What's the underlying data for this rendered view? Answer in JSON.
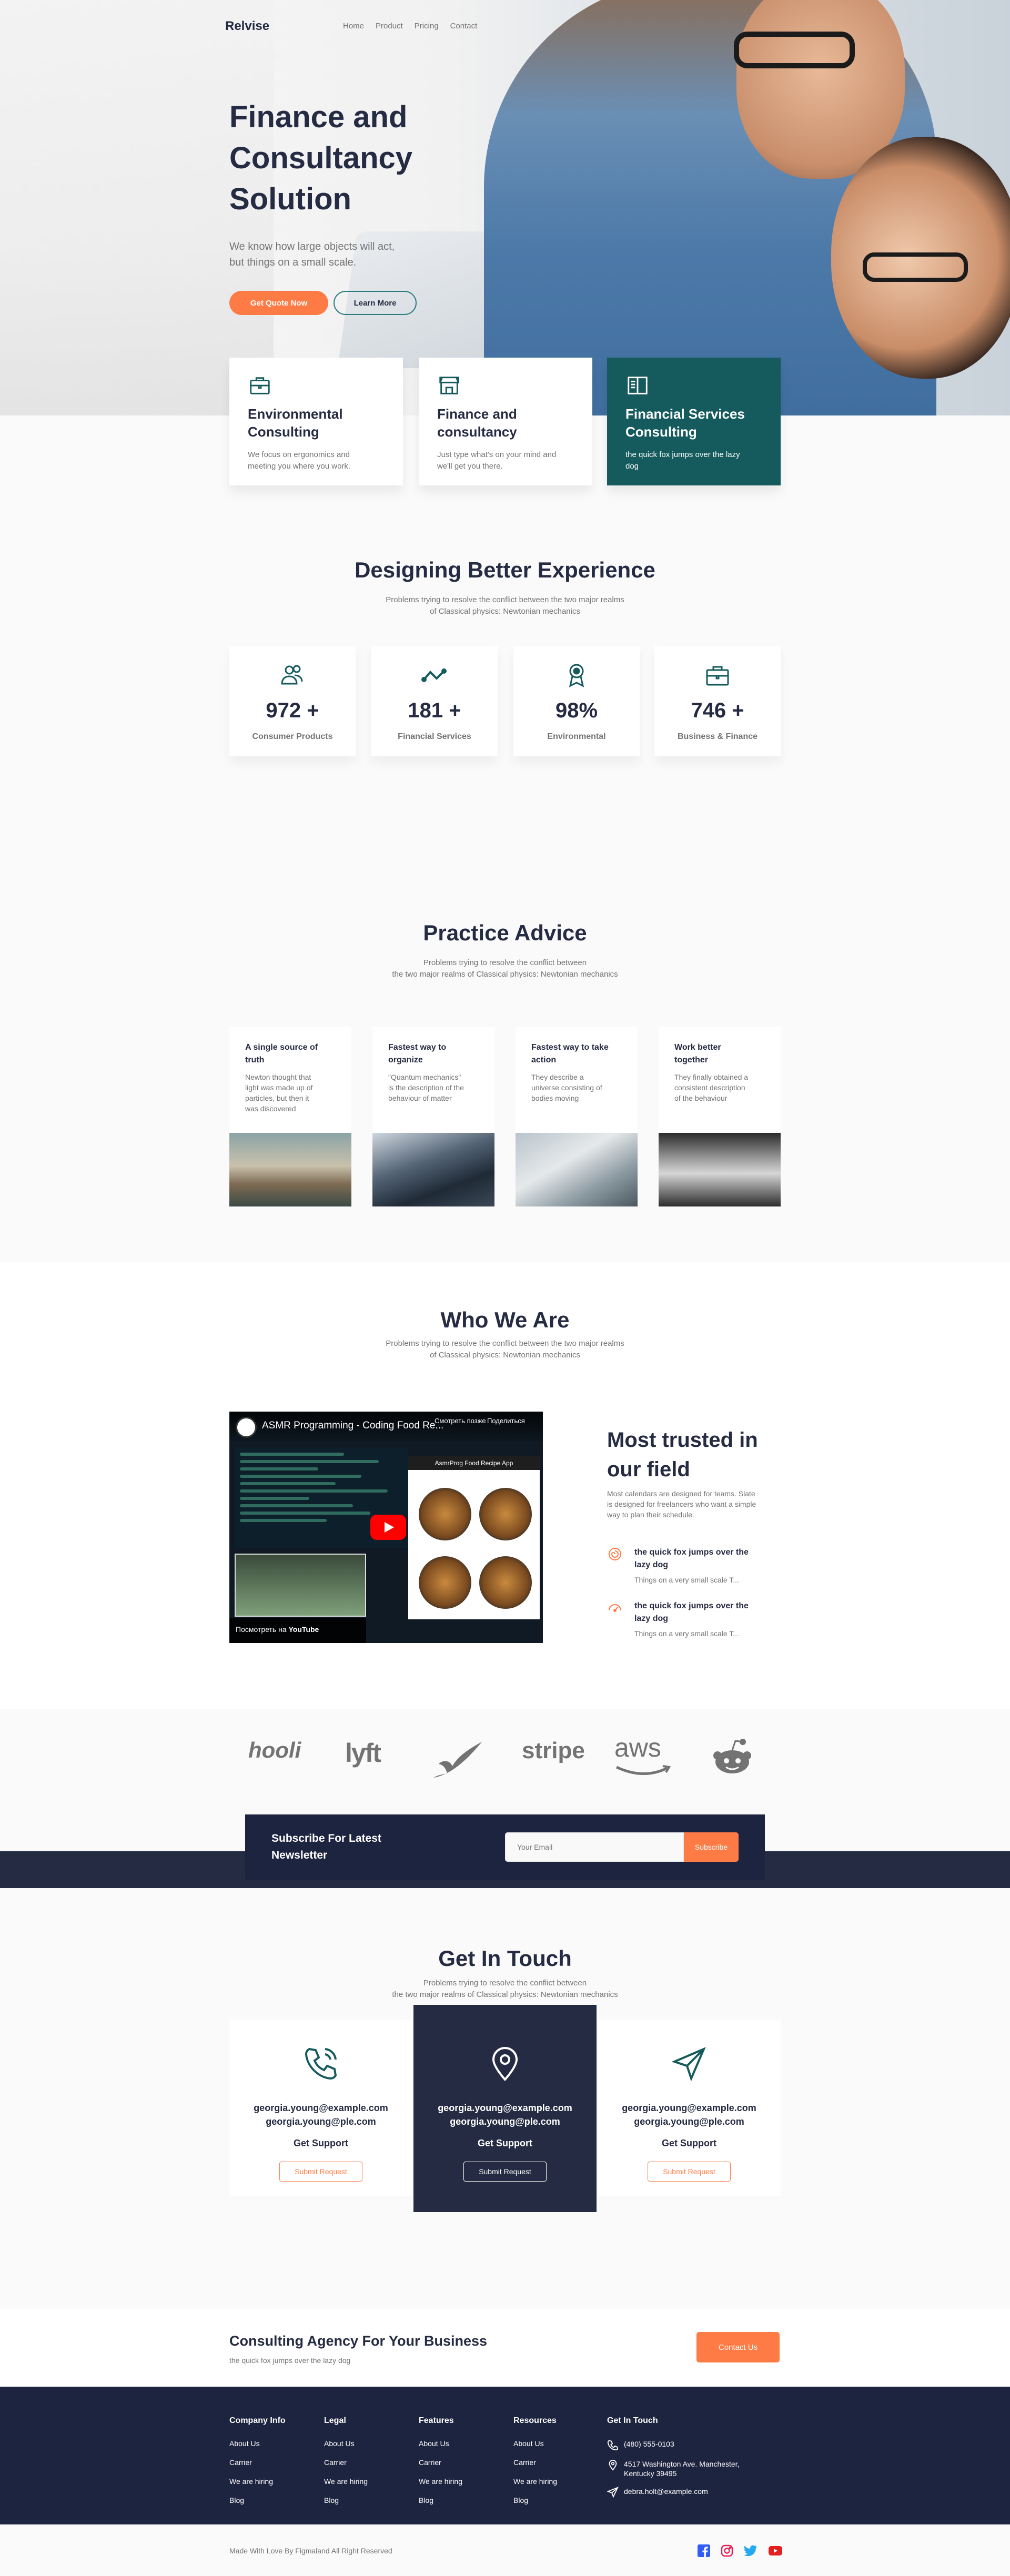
{
  "nav": {
    "logo": "Relvise",
    "links": [
      "Home",
      "Product",
      "Pricing",
      "Contact"
    ]
  },
  "hero": {
    "title_lines": [
      "Finance and",
      "Consultancy",
      "Solution"
    ],
    "subtitle_lines": [
      "We know how large objects will act,",
      "but things on a small scale."
    ],
    "primary_button": "Get Quote Now",
    "secondary_button": "Learn More"
  },
  "features": [
    {
      "title_lines": [
        "Environmental",
        "Consulting"
      ],
      "text_lines": [
        "We focus on ergonomics and",
        "meeting you where you work."
      ],
      "icon": "briefcase-icon"
    },
    {
      "title_lines": [
        "Finance and",
        "consultancy"
      ],
      "text_lines": [
        "Just type what's on your mind and",
        "we'll get you there."
      ],
      "icon": "store-icon"
    },
    {
      "title_lines": [
        "Financial Services",
        "Consulting"
      ],
      "text_lines": [
        "the quick fox jumps over the lazy",
        "dog"
      ],
      "icon": "book-icon"
    }
  ],
  "designing": {
    "title": "Designing Better Experience",
    "subtitle_lines": [
      "Problems trying to resolve the conflict between the two major realms",
      "of Classical physics: Newtonian mechanics"
    ],
    "stats": [
      {
        "value": "972 +",
        "label": "Consumer Products",
        "icon": "users-icon"
      },
      {
        "value": "181 +",
        "label": "Financial Services",
        "icon": "zigzag-icon"
      },
      {
        "value": "98%",
        "label": "Environmental",
        "icon": "award-icon"
      },
      {
        "value": "746 +",
        "label": "Business & Finance",
        "icon": "briefcase-icon"
      }
    ]
  },
  "practice": {
    "title": "Practice Advice",
    "subtitle_lines": [
      "Problems trying to resolve the conflict between",
      "the two major realms of Classical physics: Newtonian mechanics"
    ],
    "cards": [
      {
        "title_lines": [
          "A single source of",
          "truth"
        ],
        "text_lines": [
          "Newton thought that",
          "light was made up of",
          "particles, but then it",
          "was discovered"
        ]
      },
      {
        "title_lines": [
          "Fastest way to",
          "organize"
        ],
        "text_lines": [
          "\"Quantum mechanics\"",
          "is the description of the",
          "behaviour of matter"
        ]
      },
      {
        "title_lines": [
          "Fastest way to take",
          "action"
        ],
        "text_lines": [
          "They describe a",
          "universe consisting of",
          "bodies moving"
        ]
      },
      {
        "title_lines": [
          "Work better",
          "together"
        ],
        "text_lines": [
          "They finally obtained a",
          "consistent description",
          "of the behaviour"
        ]
      }
    ]
  },
  "who": {
    "title": "Who We Are",
    "subtitle_lines": [
      "Problems trying to resolve the conflict between the two major realms",
      "of Classical physics: Newtonian mechanics"
    ],
    "video": {
      "title": "ASMR Programming - Coding Food Re...",
      "watch_later": "Смотреть позже",
      "share": "Поделиться",
      "app_header": "AsmrProg Food Recipe App",
      "watch_on": "Посмотреть на",
      "youtube": "YouTube"
    },
    "trusted_title_lines": [
      "Most trusted in",
      "our field"
    ],
    "trusted_desc_lines": [
      "Most calendars are designed for teams. Slate",
      "is designed for freelancers who want a simple",
      "way to plan their schedule."
    ],
    "items": [
      {
        "title_lines": [
          "the quick fox jumps over the",
          "lazy dog"
        ],
        "text": "Things on a very small scale T...",
        "icon": "spiral-icon"
      },
      {
        "title_lines": [
          "the quick fox jumps over the",
          "lazy dog"
        ],
        "text": "Things on a very small scale T...",
        "icon": "speedometer-icon"
      }
    ]
  },
  "clients": [
    "hooli",
    "lyft",
    "feather-logo",
    "stripe",
    "aws",
    "reddit-logo"
  ],
  "subscribe": {
    "title_lines": [
      "Subscribe For Latest",
      "Newsletter"
    ],
    "placeholder": "Your Email",
    "button": "Subscribe"
  },
  "touch": {
    "title": "Get In Touch",
    "subtitle_lines": [
      "Problems trying to resolve the conflict between",
      "the two major realms of Classical physics: Newtonian mechanics"
    ],
    "cards": [
      {
        "emails": [
          "georgia.young@example.com",
          "georgia.young@ple.com"
        ],
        "label": "Get Support",
        "button": "Submit Request",
        "icon": "phone-icon"
      },
      {
        "emails": [
          "georgia.young@example.com",
          "georgia.young@ple.com"
        ],
        "label": "Get Support",
        "button": "Submit Request",
        "icon": "location-pin-icon"
      },
      {
        "emails": [
          "georgia.young@example.com",
          "georgia.young@ple.com"
        ],
        "label": "Get Support",
        "button": "Submit Request",
        "icon": "send-icon"
      }
    ]
  },
  "cta": {
    "title": "Consulting Agency For Your Business",
    "subtitle": "the quick fox jumps over the lazy dog",
    "button": "Contact Us"
  },
  "footer": {
    "columns": [
      {
        "title": "Company Info",
        "links": [
          "About Us",
          "Carrier",
          "We are hiring",
          "Blog"
        ]
      },
      {
        "title": "Legal",
        "links": [
          "About Us",
          "Carrier",
          "We are hiring",
          "Blog"
        ]
      },
      {
        "title": "Features",
        "links": [
          "About Us",
          "Carrier",
          "We are hiring",
          "Blog"
        ]
      },
      {
        "title": "Resources",
        "links": [
          "About Us",
          "Carrier",
          "We are hiring",
          "Blog"
        ]
      }
    ],
    "contact": {
      "title": "Get In Touch",
      "phone": "(480) 555-0103",
      "address_lines": [
        "4517 Washington Ave. Manchester,",
        "Kentucky 39495"
      ],
      "email": "debra.holt@example.com"
    },
    "copyright": "Made With Love By Figmaland All Right Reserved",
    "social": [
      "facebook-icon",
      "instagram-icon",
      "twitter-icon",
      "youtube-icon"
    ]
  },
  "colors": {
    "primary": "#ff7b45",
    "dark": "#252b42",
    "teal": "#155b5e",
    "navy": "#1d2440",
    "muted": "#737373"
  }
}
